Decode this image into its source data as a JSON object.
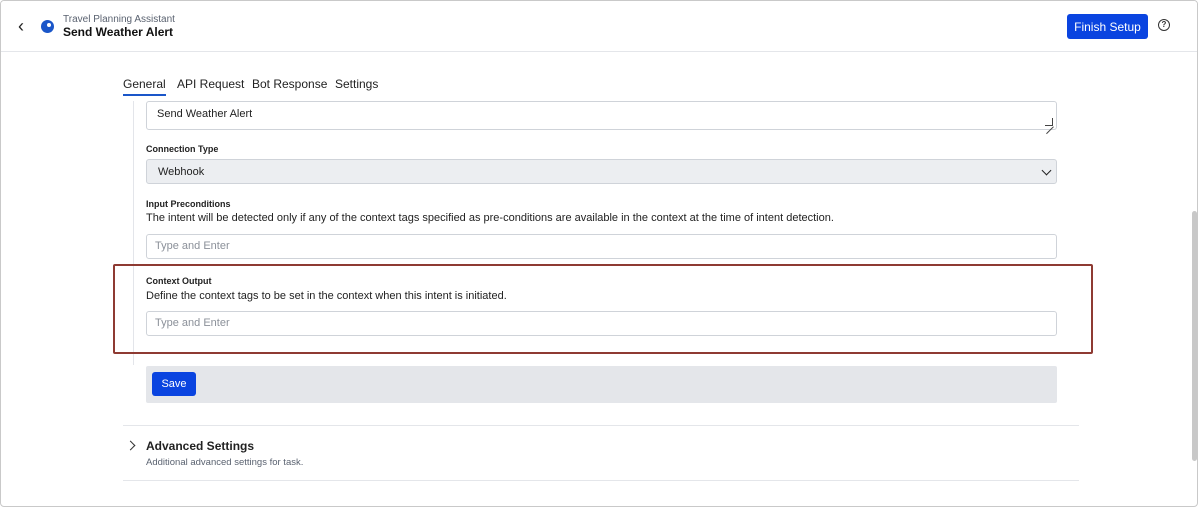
{
  "header": {
    "subtitle": "Travel Planning Assistant",
    "title": "Send Weather Alert",
    "finish_label": "Finish Setup"
  },
  "tabs": [
    {
      "label": "General",
      "active": true
    },
    {
      "label": "API Request",
      "active": false
    },
    {
      "label": "Bot Response",
      "active": false
    },
    {
      "label": "Settings",
      "active": false
    }
  ],
  "form": {
    "name_value": "Send Weather Alert",
    "connection_type": {
      "label": "Connection Type",
      "value": "Webhook"
    },
    "input_preconditions": {
      "label": "Input Preconditions",
      "description": "The intent will be detected only if any of the context tags specified as pre-conditions are available in the context at the time of intent detection.",
      "placeholder": "Type and Enter"
    },
    "context_output": {
      "label": "Context Output",
      "description": "Define the context tags to be set in the context when this intent is initiated.",
      "placeholder": "Type and Enter"
    },
    "save_label": "Save"
  },
  "advanced": {
    "title": "Advanced Settings",
    "description": "Additional advanced settings for task."
  },
  "colors": {
    "primary": "#0a44e0",
    "highlight_border": "#8e3a32",
    "tab_underline": "#1a56c9"
  }
}
